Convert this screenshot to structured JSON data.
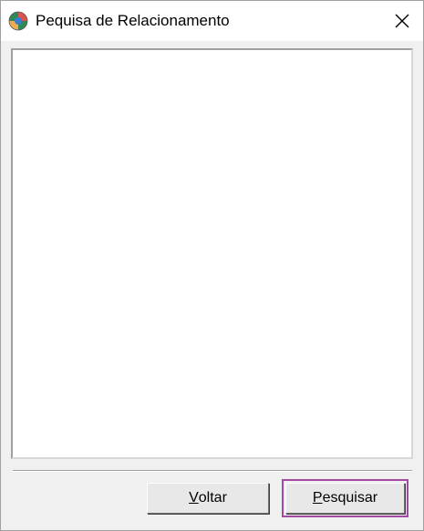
{
  "window": {
    "title": "Pequisa de Relacionamento",
    "close_icon": "close-icon",
    "app_icon": "globe-app-icon"
  },
  "buttons": {
    "voltar": {
      "accel": "V",
      "rest": "oltar"
    },
    "pesquisar": {
      "accel": "P",
      "rest": "esquisar"
    }
  },
  "colors": {
    "highlight": "#a349a4",
    "dialog_bg": "#f0f0f0"
  }
}
